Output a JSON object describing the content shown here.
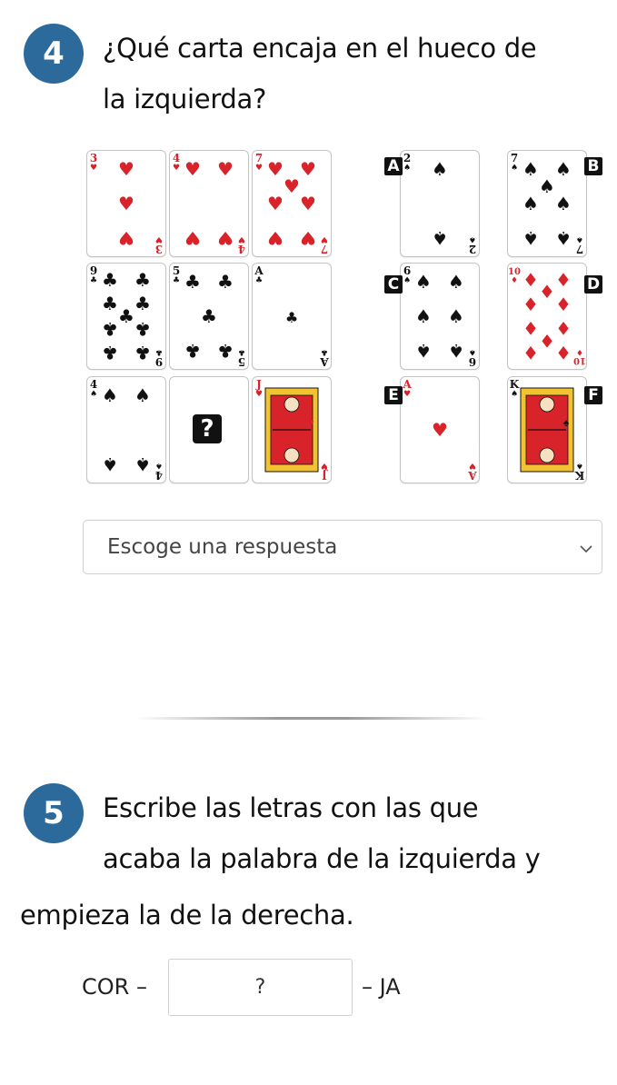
{
  "question4": {
    "number": "4",
    "line1": "¿Qué carta encaja en el hueco de",
    "line2": "la izquierda?",
    "unknown_mark": "?",
    "grid": [
      {
        "rank": "3",
        "suit": "hearts",
        "color": "#d8232a"
      },
      {
        "rank": "4",
        "suit": "hearts",
        "color": "#d8232a"
      },
      {
        "rank": "7",
        "suit": "hearts",
        "color": "#d8232a"
      },
      {
        "rank": "9",
        "suit": "clubs",
        "color": "#111111"
      },
      {
        "rank": "5",
        "suit": "clubs",
        "color": "#111111"
      },
      {
        "rank": "A",
        "suit": "clubs",
        "color": "#111111"
      },
      {
        "rank": "4",
        "suit": "spades",
        "color": "#111111"
      },
      {
        "rank": "?",
        "suit": "unknown",
        "color": "#111111"
      },
      {
        "rank": "J",
        "suit": "hearts",
        "color": "#d8232a"
      }
    ],
    "options": [
      {
        "letter": "A",
        "rank": "2",
        "suit": "spades",
        "color": "#111111"
      },
      {
        "letter": "B",
        "rank": "7",
        "suit": "spades",
        "color": "#111111"
      },
      {
        "letter": "C",
        "rank": "6",
        "suit": "spades",
        "color": "#111111"
      },
      {
        "letter": "D",
        "rank": "10",
        "suit": "diamonds",
        "color": "#d8232a"
      },
      {
        "letter": "E",
        "rank": "A",
        "suit": "hearts",
        "color": "#d8232a"
      },
      {
        "letter": "F",
        "rank": "K",
        "suit": "spades",
        "color": "#111111"
      }
    ],
    "select_placeholder": "Escoge una respuesta",
    "selected_value": ""
  },
  "question5": {
    "number": "5",
    "line1": "Escribe las letras con las que",
    "line2": "acaba la palabra de la izquierda y",
    "line3": "empieza la de la derecha.",
    "left_word": "COR –",
    "right_word": "– JA",
    "answer_placeholder": "?"
  }
}
